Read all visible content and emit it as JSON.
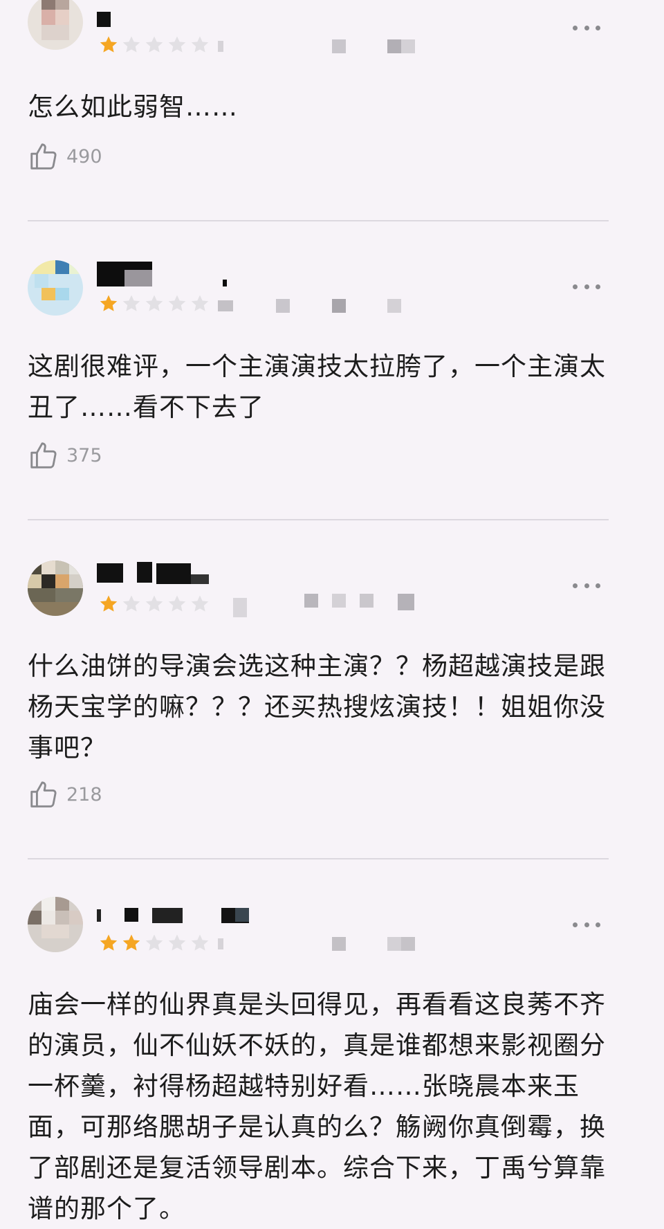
{
  "reviews": [
    {
      "rating": 1,
      "max_rating": 5,
      "content": "怎么如此弱智……",
      "likes": "490"
    },
    {
      "rating": 1,
      "max_rating": 5,
      "content": "这剧很难评，一个主演演技太拉胯了，一个主演太丑了……看不下去了",
      "likes": "375"
    },
    {
      "rating": 1,
      "max_rating": 5,
      "content": "什么油饼的导演会选这种主演？？杨超越演技是跟杨天宝学的嘛？？？还买热搜炫演技！！姐姐你没事吧？",
      "likes": "218"
    },
    {
      "rating": 2,
      "max_rating": 5,
      "content": "庙会一样的仙界真是头回得见，再看看这良莠不齐的演员，仙不仙妖不妖的，真是谁都想来影视圈分一杯羹，衬得杨超越特别好看……张晓晨本来玉面，可那络腮胡子是认真的么？觞阙你真倒霉，换了部剧还是复活领导剧本。综合下来，丁禹兮算靠谱的那个了。",
      "likes": ""
    }
  ],
  "colors": {
    "star_filled": "#f5a623",
    "star_empty": "#e2e0e4",
    "text": "#1c1c1c",
    "like_count": "#9a9a9e",
    "background": "#f7f3f8"
  },
  "icons": {
    "thumb": "thumbs-up-icon",
    "more": "more-options-icon",
    "star": "star-icon"
  }
}
